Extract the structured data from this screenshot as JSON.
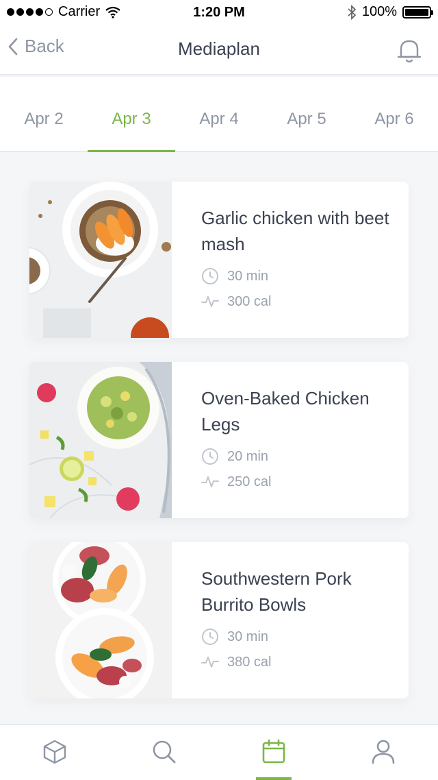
{
  "status_bar": {
    "carrier": "Carrier",
    "time": "1:20 PM",
    "battery": "100%"
  },
  "nav": {
    "back_label": "Back",
    "title": "Mediaplan"
  },
  "date_tabs": [
    {
      "label": "Apr 2"
    },
    {
      "label": "Apr 3",
      "active": true
    },
    {
      "label": "Apr 4"
    },
    {
      "label": "Apr 5"
    },
    {
      "label": "Apr 6"
    }
  ],
  "recipes": [
    {
      "title": "Garlic chicken with beet mash",
      "time": "30 min",
      "calories": "300 cal",
      "image": "granola-peach-bowl"
    },
    {
      "title": "Oven-Baked Chicken Legs",
      "time": "20 min",
      "calories": "250 cal",
      "image": "avocado-salad-bowl"
    },
    {
      "title": "Southwestern Pork Burrito Bowls",
      "time": "30 min",
      "calories": "380 cal",
      "image": "prosciutto-melon-plates"
    }
  ],
  "tab_bar": {
    "items": [
      "box-icon",
      "search-icon",
      "calendar-icon",
      "profile-icon"
    ],
    "active_index": 2
  },
  "colors": {
    "accent": "#7ab648",
    "text": "#3b4252",
    "muted": "#8e96a3",
    "background": "#f4f6f8"
  }
}
